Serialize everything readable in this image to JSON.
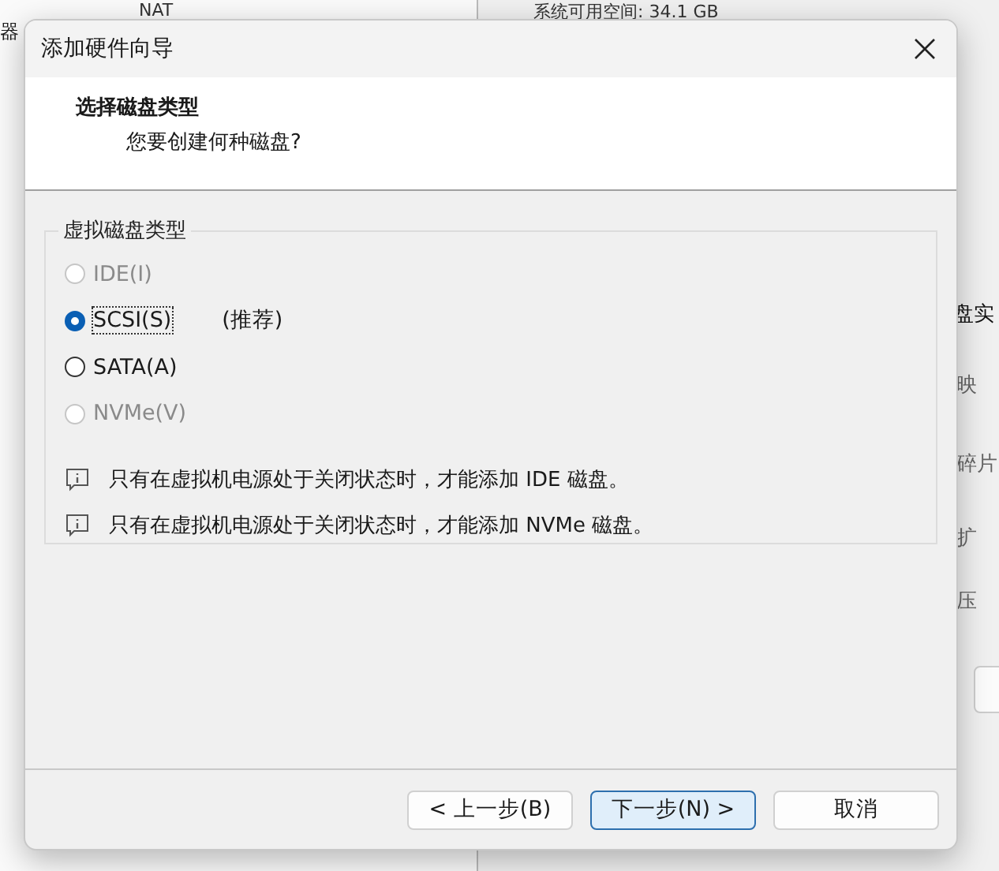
{
  "background": {
    "left_label": "器",
    "network": "NAT",
    "disk_space": "系统可用空间: 34.1 GB",
    "side_labels": [
      "盘实",
      "映",
      "碎片",
      "扩",
      "压"
    ]
  },
  "dialog": {
    "title": "添加硬件向导",
    "heading": "选择磁盘类型",
    "subheading": "您要创建何种磁盘?",
    "group_label": "虚拟磁盘类型",
    "options": [
      {
        "label": "IDE(I)",
        "selected": false,
        "disabled": true
      },
      {
        "label": "SCSI(S)",
        "selected": true,
        "disabled": false,
        "note": "(推荐)"
      },
      {
        "label": "SATA(A)",
        "selected": false,
        "disabled": false
      },
      {
        "label": "NVMe(V)",
        "selected": false,
        "disabled": true
      }
    ],
    "infos": [
      "只有在虚拟机电源处于关闭状态时，才能添加 IDE 磁盘。",
      "只有在虚拟机电源处于关闭状态时，才能添加 NVMe 磁盘。"
    ],
    "buttons": [
      {
        "label": "< 上一步(B)",
        "default": false
      },
      {
        "label": "下一步(N) >",
        "default": true
      },
      {
        "label": "取消",
        "default": false
      }
    ]
  }
}
